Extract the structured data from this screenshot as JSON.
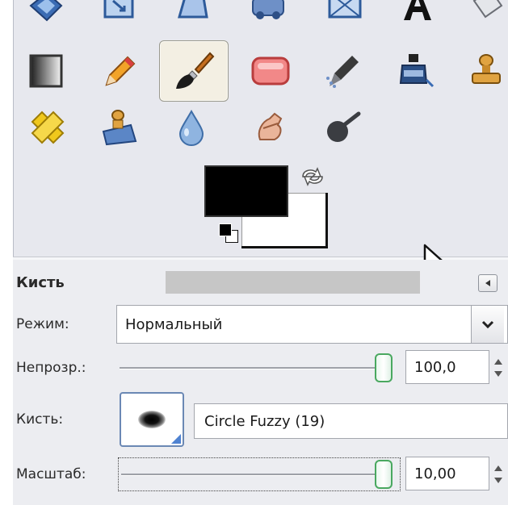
{
  "toolbox": {
    "rows": [
      [
        "align-icon",
        "scale-icon",
        "perspective-icon",
        "flip-icon",
        "cage-icon",
        "text-icon",
        "measure-icon"
      ],
      [
        "blend-icon",
        "pencil-icon",
        "paintbrush-icon",
        "eraser-icon",
        "airbrush-icon",
        "ink-icon",
        "clone-icon"
      ],
      [
        "heal-icon",
        "perspective-clone-icon",
        "blur-sharpen-icon",
        "smudge-icon",
        "dodge-burn-icon"
      ]
    ],
    "selected_tool": "paintbrush-icon",
    "foreground_color": "#000000",
    "background_color": "#ffffff"
  },
  "tool_options": {
    "title": "Кисть",
    "mode": {
      "label": "Режим:",
      "value": "Нормальный"
    },
    "opacity": {
      "label": "Непрозр.:",
      "value": "100,0",
      "level": 1.0
    },
    "brush": {
      "label": "Кисть:",
      "value": "Circle Fuzzy (19)"
    },
    "scale": {
      "label": "Масштаб:",
      "value": "10,00",
      "level": 1.0
    }
  }
}
